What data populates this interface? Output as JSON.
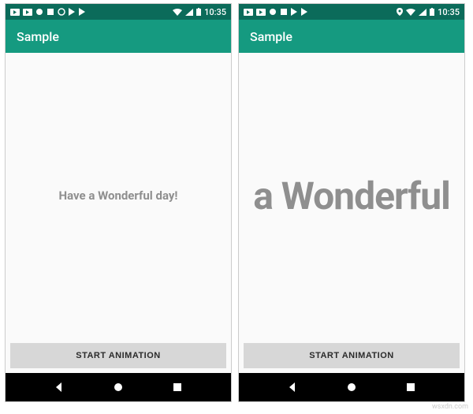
{
  "status": {
    "time": "10:35"
  },
  "appbar": {
    "title": "Sample"
  },
  "screen_left": {
    "message": "Have a Wonderful day!",
    "button_label": "START ANIMATION"
  },
  "screen_right": {
    "message_visible": "a Wonderful",
    "button_label": "START ANIMATION"
  },
  "watermark": "wsxdn.com"
}
